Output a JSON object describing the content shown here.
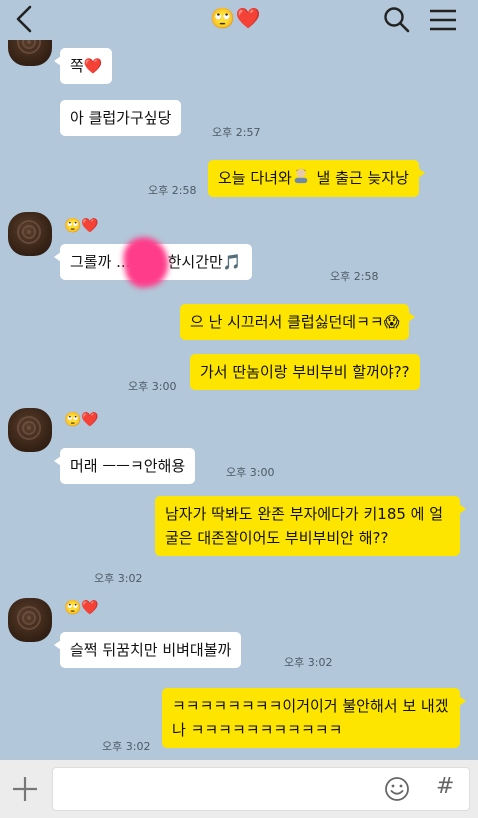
{
  "header": {
    "title": "🙄❤️"
  },
  "messages": [
    {
      "name": "",
      "text": "쪽❤️",
      "time": ""
    },
    {
      "text": "아 클럽가구싶당",
      "time": "오후 2:57"
    },
    {
      "text_before": "오늘 다녀와",
      "text_after": " 낼 출근 늦자낭",
      "time": "오후 2:58"
    },
    {
      "name": "🙄❤️",
      "text": "그롤까 ...랑 딱 한시간만🎵",
      "time": "오후 2:58"
    },
    {
      "text": "으 난 시끄러서 클럽싫던데ㅋㅋ😱",
      "time": ""
    },
    {
      "text": "가서 딴놈이랑 부비부비 할꺼야??",
      "time": "오후 3:00"
    },
    {
      "name": "🙄❤️",
      "text": "머래 ㅡㅡㅋ안해용",
      "time": "오후 3:00"
    },
    {
      "text": "남자가 딱봐도 완존 부자에다가 키185 에 얼굴은 대존잘이어도 부비부비안 해??",
      "time": "오후 3:02"
    },
    {
      "name": "🙄❤️",
      "text": "슬쩍 뒤꿈치만 비벼대볼까",
      "time": "오후 3:02"
    },
    {
      "text": "ㅋㅋㅋㅋㅋㅋㅋㅋ이거이거 불안해서 보 내겠나 ㅋㅋㅋㅋㅋㅋㅋㅋㅋㅋㅋ",
      "time": "오후 3:02"
    }
  ],
  "icons": {
    "back": "back-arrow-icon",
    "search": "search-icon",
    "menu": "hamburger-menu-icon",
    "attach": "plus-icon",
    "emoticon": "smile-icon",
    "hash": "hash-icon"
  },
  "colors": {
    "background": "#b2c7d9",
    "incoming": "#ffffff",
    "outgoing": "#fee500"
  },
  "input": {
    "value": "",
    "placeholder": ""
  },
  "hash_label": "#"
}
